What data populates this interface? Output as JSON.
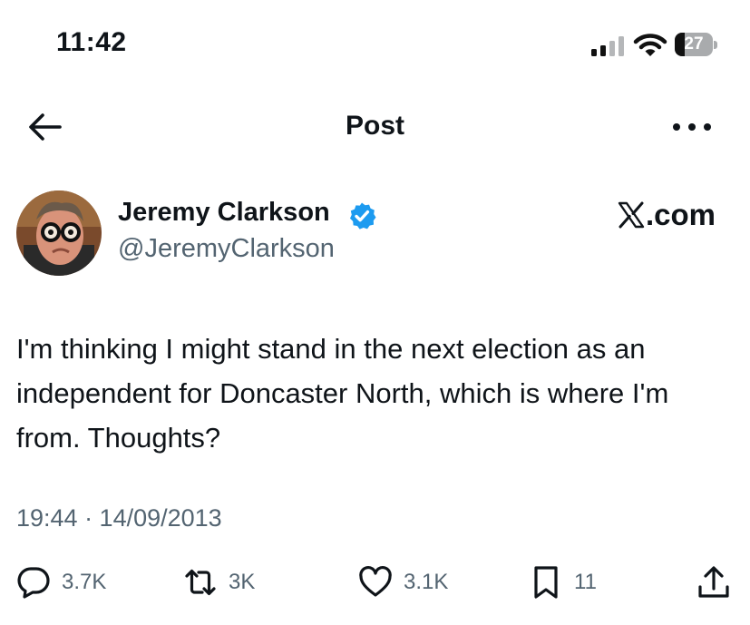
{
  "status_bar": {
    "time": "11:42",
    "battery_level": "27"
  },
  "header": {
    "title": "Post"
  },
  "author": {
    "name": "Jeremy Clarkson",
    "handle": "@JeremyClarkson",
    "verified": true,
    "source_label": ".com"
  },
  "post": {
    "text": "I'm thinking I might stand in the next election as an independent for Doncaster North, which is where I'm from. Thoughts?",
    "timestamp": "19:44 · 14/09/2013"
  },
  "actions": {
    "replies": "3.7K",
    "reposts": "3K",
    "likes": "3.1K",
    "bookmarks": "11"
  },
  "icons": {
    "back": "arrow-left-icon",
    "more": "ellipsis-icon",
    "verified": "verified-badge-icon",
    "reply": "speech-bubble-icon",
    "repost": "repost-icon",
    "like": "heart-icon",
    "bookmark": "bookmark-icon",
    "share": "share-icon"
  },
  "colors": {
    "text": "#0f1419",
    "secondary": "#536471",
    "verified": "#1d9bf0"
  }
}
